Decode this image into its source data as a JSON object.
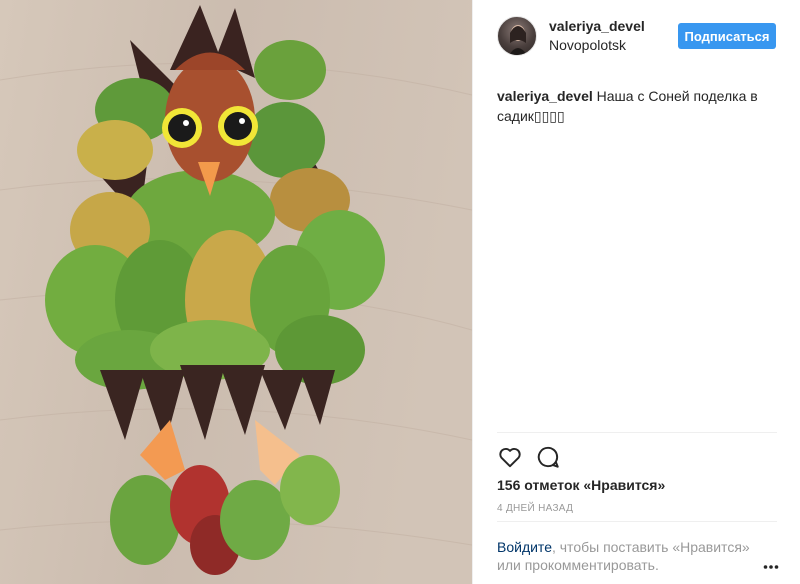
{
  "post": {
    "username": "valeriya_devel",
    "location": "Novopolotsk",
    "follow_label": "Подписаться",
    "caption_user": "valeriya_devel",
    "caption_text": "Наша с Соней поделка в садик▯▯▯▯",
    "likes": "156 отметок «Нравится»",
    "timestamp": "4 ДНЕЙ НАЗАД",
    "login_link": "Войдите",
    "login_rest": ", чтобы поставить «Нравится» или прокомментировать.",
    "icons": {
      "like": "heart-icon",
      "comment": "comment-icon",
      "more": "more-dots-icon"
    },
    "colors": {
      "accent": "#3897f0",
      "link": "#003569",
      "muted": "#999999"
    }
  }
}
